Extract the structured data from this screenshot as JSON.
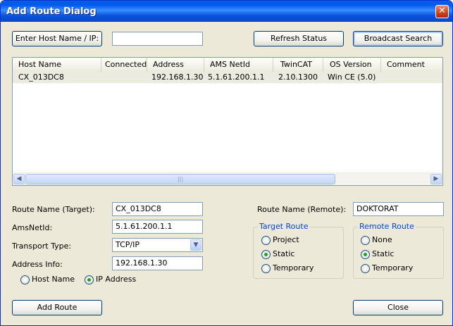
{
  "window": {
    "title": "Add Route Dialog",
    "close_glyph": "✕"
  },
  "top": {
    "host_button": "Enter Host Name / IP:",
    "host_value": "",
    "refresh_button": "Refresh Status",
    "broadcast_button": "Broadcast Search"
  },
  "list": {
    "columns": [
      "Host Name",
      "Connected",
      "Address",
      "AMS NetId",
      "TwinCAT",
      "OS Version",
      "Comment"
    ],
    "rows": [
      [
        "CX_013DC8",
        "",
        "192.168.1.30",
        "5.1.61.200.1.1",
        "2.10.1300",
        "Win CE (5.0)",
        ""
      ]
    ],
    "scroll_left": "◀",
    "scroll_right": "▶",
    "scroll_grip": "|||"
  },
  "form": {
    "route_name_target_label": "Route Name (Target):",
    "route_name_target_value": "CX_013DC8",
    "amsnetid_label": "AmsNetId:",
    "amsnetid_value": "5.1.61.200.1.1",
    "transport_label": "Transport Type:",
    "transport_value": "TCP/IP",
    "address_label": "Address Info:",
    "address_value": "192.168.1.30",
    "host_name_radio": "Host Name",
    "ip_address_radio": "IP Address",
    "route_name_remote_label": "Route Name (Remote):",
    "route_name_remote_value": "DOKTORAT"
  },
  "target_route": {
    "title": "Target Route",
    "project": "Project",
    "static": "Static",
    "temporary": "Temporary"
  },
  "remote_route": {
    "title": "Remote Route",
    "none": "None",
    "static": "Static",
    "temporary": "Temporary"
  },
  "bottom": {
    "add_route_button": "Add Route",
    "close_button": "Close"
  }
}
